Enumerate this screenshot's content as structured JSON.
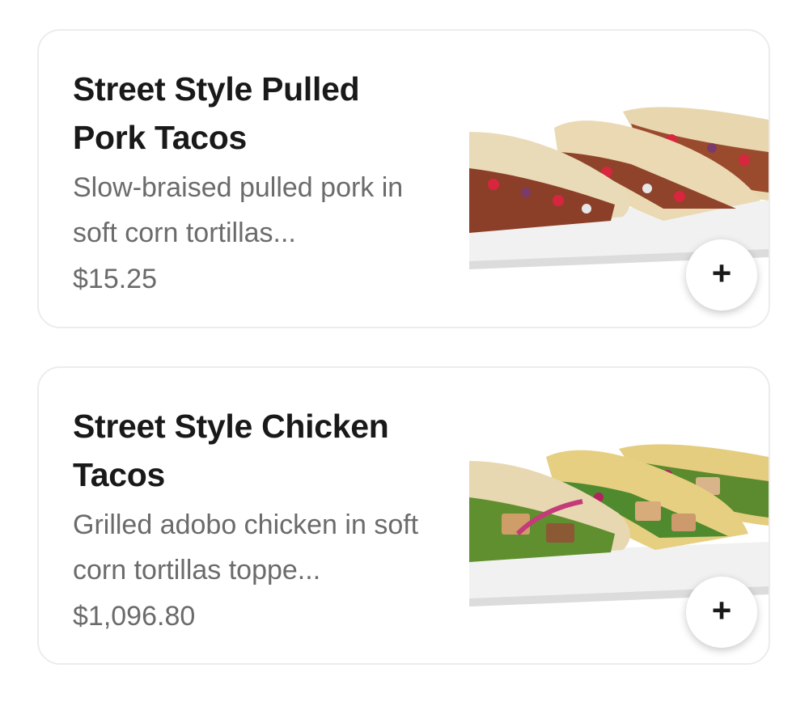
{
  "menu_items": [
    {
      "name": "Street Style Pulled Pork Tacos",
      "description": "Slow-braised pulled pork in soft corn tortillas...",
      "price": "$15.25",
      "image_icon": "pulled-pork-tacos-image",
      "add_icon": "plus-icon",
      "add_symbol": "+"
    },
    {
      "name": "Street Style Chicken Tacos",
      "description": "Grilled adobo chicken in soft corn tortillas toppe...",
      "price": "$1,096.80",
      "image_icon": "chicken-tacos-image",
      "add_icon": "plus-icon",
      "add_symbol": "+"
    }
  ],
  "colors": {
    "title": "#191919",
    "text_secondary": "#6b6b6b",
    "card_border": "#ececec",
    "background": "#ffffff"
  }
}
